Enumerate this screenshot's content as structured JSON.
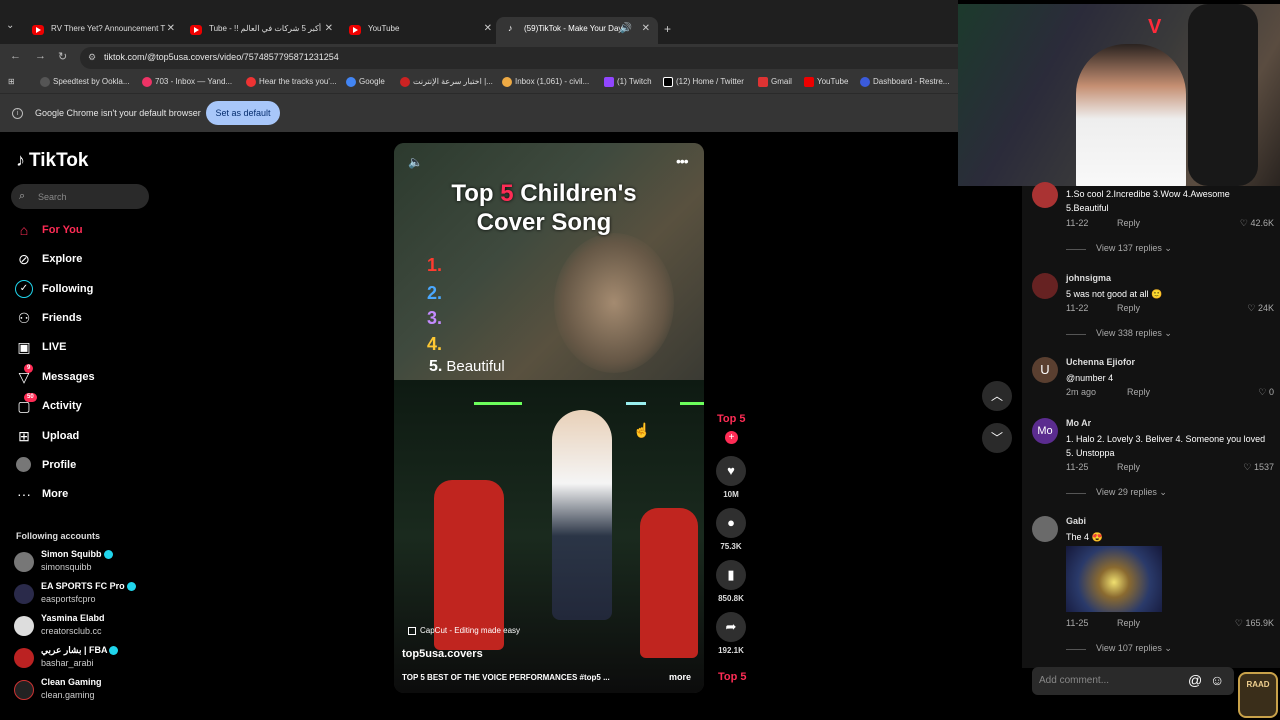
{
  "browser": {
    "tabs": [
      {
        "title": "RV There Yet? Announcement T"
      },
      {
        "title": "Tube - !! أكبر 5 شركات في العالم"
      },
      {
        "title": "YouTube"
      },
      {
        "title": "(59)TikTok - Make Your Day"
      }
    ],
    "url": "tiktok.com/@top5usa.covers/video/7574857795871231254",
    "bookmarks": [
      "Speedtest by Ookla...",
      "703 - Inbox — Yand...",
      "Hear the tracks you'...",
      "Google",
      "اختبار سرعة الإنترنت |...",
      "Inbox (1,061) - civil...",
      "(1) Twitch",
      "(12) Home / Twitter",
      "Gmail",
      "YouTube",
      "Dashboard - Restre..."
    ],
    "infobar": {
      "text": "Google Chrome isn't your default browser",
      "button": "Set as default"
    }
  },
  "sidebar": {
    "logo": "TikTok",
    "search_placeholder": "Search",
    "nav": [
      {
        "label": "For You",
        "icon": "home-icon"
      },
      {
        "label": "Explore",
        "icon": "compass-icon"
      },
      {
        "label": "Following",
        "icon": "following-icon"
      },
      {
        "label": "Friends",
        "icon": "friends-icon"
      },
      {
        "label": "LIVE",
        "icon": "live-icon"
      },
      {
        "label": "Messages",
        "icon": "messages-icon",
        "badge": "9"
      },
      {
        "label": "Activity",
        "icon": "activity-icon",
        "badge": "50"
      },
      {
        "label": "Upload",
        "icon": "upload-icon"
      },
      {
        "label": "Profile",
        "icon": "profile-icon"
      },
      {
        "label": "More",
        "icon": "more-icon"
      }
    ],
    "following_title": "Following accounts",
    "accounts": [
      {
        "name": "Simon Squibb",
        "handle": "simonsquibb"
      },
      {
        "name": "EA SPORTS FC Pro",
        "handle": "easportsfcpro"
      },
      {
        "name": "Yasmina Elabd",
        "handle": "creatorsclub.cc"
      },
      {
        "name": "بشار عربي | FBA",
        "handle": "bashar_arabi"
      },
      {
        "name": "Clean Gaming",
        "handle": "clean.gaming"
      }
    ]
  },
  "video": {
    "title_pre": "Top ",
    "title_num": "5",
    "title_post": " Children's",
    "title_line2": "Cover Song",
    "ranks": [
      "1.",
      "2.",
      "3.",
      "4."
    ],
    "rank5_num": "5.",
    "rank5_text": "Beautiful",
    "capcut": "CapCut - Editing made easy",
    "author": "top5usa.covers",
    "description": "TOP 5 BEST OF THE VOICE PERFORMANCES #top5 ...",
    "more": "more"
  },
  "actions": {
    "profile_label": "Top 5",
    "likes": "10M",
    "comments": "75.3K",
    "saves": "850.8K",
    "shares": "192.1K",
    "music_label": "Top 5"
  },
  "comments": [
    {
      "name": "",
      "text": "1.So cool 2.Incredibe 3.Wow 4.Awesome 5.Beautiful",
      "date": "11-22",
      "likes": "42.6K",
      "replies": "View 137 replies"
    },
    {
      "name": "johnsigma",
      "text": "5 was not good at all 🙂",
      "date": "11-22",
      "likes": "24K",
      "replies": "View 338 replies"
    },
    {
      "name": "Uchenna Ejiofor",
      "avatar": "U",
      "text": "@number 4",
      "date": "2m ago",
      "likes": "0"
    },
    {
      "name": "Mo Ar",
      "avatar": "Mo",
      "text": "1. Halo 2. Lovely 3. Beliver 4. Someone you loved 5. Unstoppa",
      "date": "11-25",
      "likes": "1537",
      "replies": "View 29 replies"
    },
    {
      "name": "Gabi",
      "text": "The 4 😍",
      "date": "11-25",
      "likes": "165.9K",
      "replies": "View 107 replies"
    }
  ],
  "reply_label": "Reply",
  "add_comment_placeholder": "Add comment...",
  "overlay_logo": "RAAD"
}
